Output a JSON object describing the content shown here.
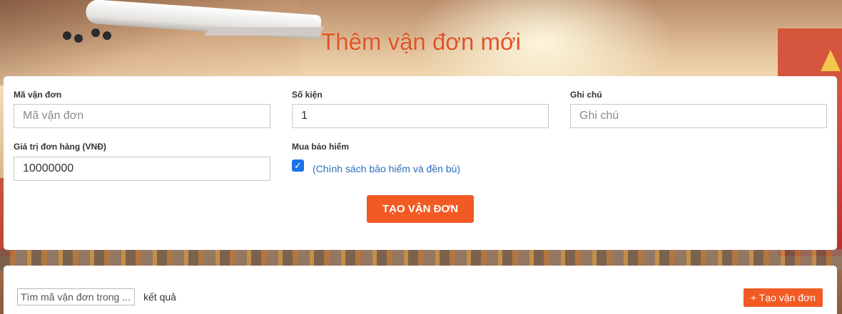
{
  "header": {
    "title": "Thêm vận đơn mới"
  },
  "form": {
    "tracking_code": {
      "label": "Mã vận đơn",
      "placeholder": "Mã vận đơn",
      "value": ""
    },
    "package_count": {
      "label": "Số kiện",
      "placeholder": "",
      "value": "1"
    },
    "note": {
      "label": "Ghi chú",
      "placeholder": "Ghi chú",
      "value": ""
    },
    "order_value": {
      "label": "Giá trị đơn hàng (VNĐ)",
      "placeholder": "",
      "value": "10000000"
    },
    "insurance": {
      "label": "Mua bảo hiểm",
      "checked": true,
      "check_glyph": "✓",
      "policy_link": "(Chính sách bảo hiểm và đền bù)"
    },
    "submit_label": "TẠO VẬN ĐƠN"
  },
  "results": {
    "search_placeholder": "Tìm mã vận đơn trong ...",
    "results_label": "kết quả",
    "add_button_label": "+ Tạo vận đơn"
  },
  "colors": {
    "accent": "#f15a22",
    "title": "#e05425",
    "link": "#2a6ebb",
    "checkbox": "#1a73e8"
  }
}
